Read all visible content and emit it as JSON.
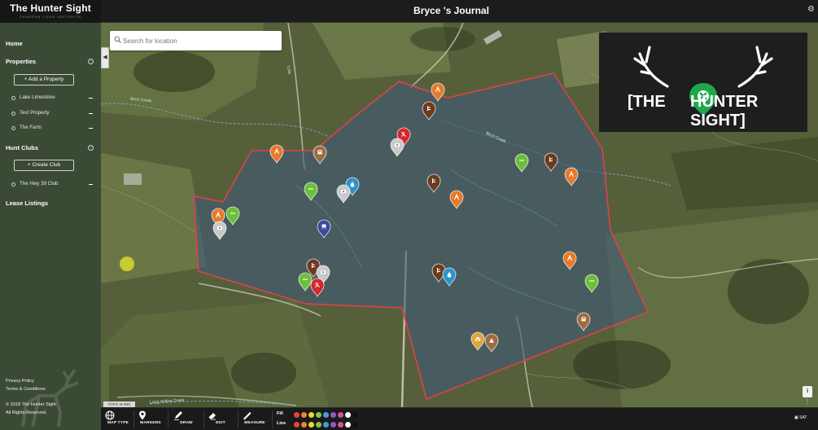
{
  "app": {
    "brand_name": "The Hunter Sight",
    "brand_tagline": "SHARPEN YOUR INSTINCTS",
    "page_title": "Bryce 's Journal"
  },
  "sidebar": {
    "home": "Home",
    "properties": "Properties",
    "add_property": "+ Add a Property",
    "property_items": [
      {
        "label": "Lake Limestone"
      },
      {
        "label": "Test Property"
      },
      {
        "label": "The Farm"
      }
    ],
    "hunt_clubs": "Hunt Clubs",
    "create_club": "+ Create Club",
    "club_items": [
      {
        "label": "The Hwy 39 Club"
      }
    ],
    "lease_listings": "Lease Listings",
    "privacy": "Privacy Policy",
    "terms": "Terms & Conditions",
    "copyright": "© 2018 The Hunter Sight",
    "rights": "All Rights Reserved."
  },
  "map": {
    "search_placeholder": "Search for location",
    "logo_left": "[THE",
    "logo_right": "HUNTER SIGHT]",
    "layer_label": "TOPO W IMG",
    "info": "i",
    "map_labels": [
      "Birch Creek",
      "Birch Creek",
      "Long Hollow Creek",
      "Lola"
    ],
    "property_color": "#e0404a"
  },
  "toolbar": {
    "map_type": "MAP TYPE",
    "markers": "MARKERS",
    "draw": "DRAW",
    "edit": "EDIT",
    "measure": "MEASURE",
    "fill_label": "Fill",
    "line_label": "Line",
    "swatches": [
      "#e8433b",
      "#f0852d",
      "#f3d42f",
      "#8bc540",
      "#3aa0d9",
      "#8e5bbf",
      "#d94ea0",
      "#ffffff",
      "#111111"
    ],
    "sat_label": "SAT"
  },
  "markers": {
    "colors": {
      "orange": "#e8792a",
      "brown": "#6b3a1f",
      "green": "#6cbf3a",
      "grey": "#c9c9c9",
      "blue": "#2e93c9",
      "red": "#d6262f",
      "navy": "#3b4a9e",
      "tan": "#a06a40",
      "yellow": "#e3a33a"
    },
    "kinds": [
      "stand",
      "tripod",
      "camera",
      "food-plot",
      "feeder",
      "water",
      "blind",
      "kill",
      "atv",
      "camp"
    ]
  }
}
